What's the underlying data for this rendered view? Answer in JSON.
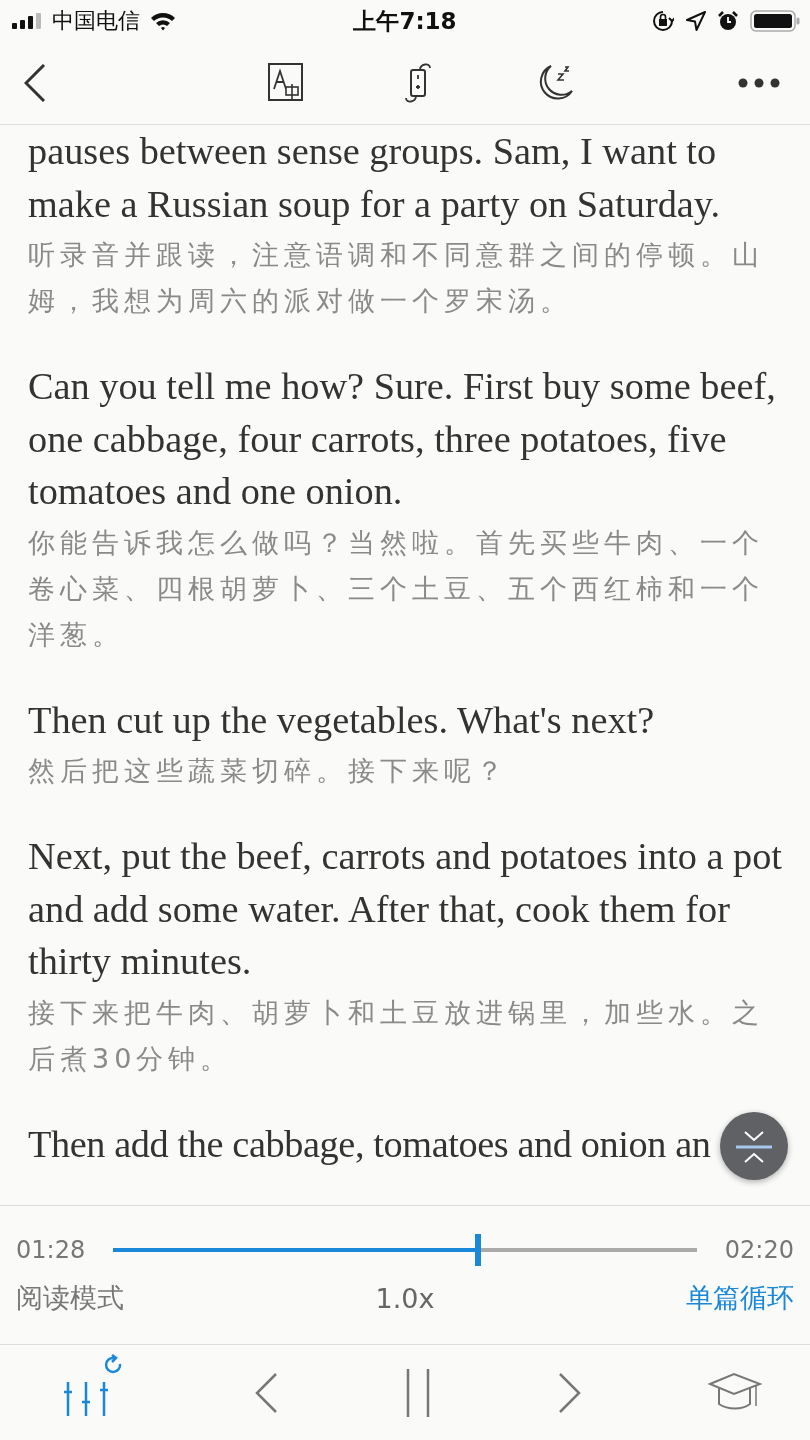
{
  "status_bar": {
    "carrier": "中国电信",
    "time": "上午7:18"
  },
  "paragraphs": [
    {
      "en": "pauses between sense groups. Sam, I want to make a Russian soup for a party on Saturday.",
      "zh": "听录音并跟读，注意语调和不同意群之间的停顿。山姆，我想为周六的派对做一个罗宋汤。"
    },
    {
      "en": "Can you tell me how? Sure. First buy some beef, one cabbage, four carrots, three potatoes, five tomatoes and one onion.",
      "zh": "你能告诉我怎么做吗？当然啦。首先买些牛肉、一个卷心菜、四根胡萝卜、三个土豆、五个西红柿和一个洋葱。"
    },
    {
      "en": "Then cut up the vegetables. What's next?",
      "zh": "然后把这些蔬菜切碎。接下来呢？"
    },
    {
      "en": "Next, put the beef, carrots and potatoes into a pot and add some water. After that, cook them for thirty minutes.",
      "zh": "接下来把牛肉、胡萝卜和土豆放进锅里，加些水。之后煮30分钟。"
    },
    {
      "en": "Then add the cabbage, tomatoes and onion an"
    }
  ],
  "player": {
    "elapsed": "01:28",
    "total": "02:20",
    "level": 0.63,
    "mode": "阅读模式",
    "speed": "1.0x",
    "loop": "单篇循环"
  }
}
